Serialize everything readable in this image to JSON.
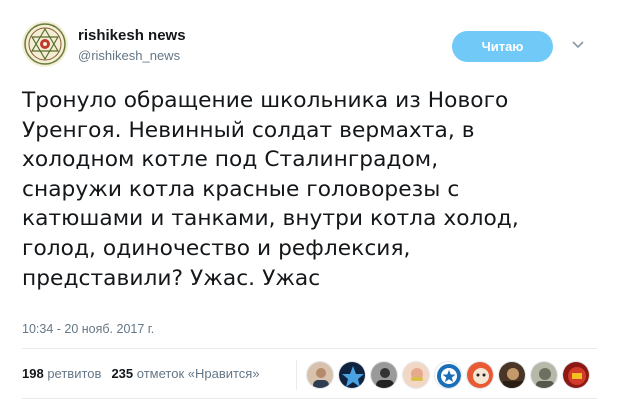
{
  "author": {
    "name": "rishikesh news",
    "handle": "@rishikesh_news"
  },
  "follow_button": "Читаю",
  "tweet": {
    "lines": [
      "Тронуло обращение школьника из Нового",
      "Уренгоя. Невинный солдат вермахта, в",
      "холодном котле под Сталинградом,",
      "снаружи котла красные головорезы с",
      "катюшами и танками, внутри котла холод,",
      "голод, одиночество и рефлексия,",
      "представили? Ужас. Ужас"
    ],
    "timestamp": "10:34 - 20 нояб. 2017 г."
  },
  "stats": {
    "retweets_count": "198",
    "retweets_label": "ретвитов",
    "likes_count": "235",
    "likes_label": "отметок «Нравится»"
  },
  "colors": {
    "follow_button": "#71c9f8",
    "text": "#14171a",
    "muted": "#657786"
  },
  "liker_avatars": [
    {
      "icon": "person-avatar",
      "color": "#c9a58a"
    },
    {
      "icon": "blue-emblem-avatar",
      "color": "#1d3557"
    },
    {
      "icon": "dark-portrait-avatar",
      "color": "#3a3a3a"
    },
    {
      "icon": "pink-portrait-avatar",
      "color": "#e6b8a2"
    },
    {
      "icon": "blue-star-avatar",
      "color": "#1b6fb8"
    },
    {
      "icon": "red-cartoon-avatar",
      "color": "#d9482b"
    },
    {
      "icon": "brown-portrait-avatar",
      "color": "#6b4a2f"
    },
    {
      "icon": "grey-portrait-avatar",
      "color": "#8a8f7a"
    },
    {
      "icon": "red-emblem-avatar",
      "color": "#b3261e"
    }
  ]
}
